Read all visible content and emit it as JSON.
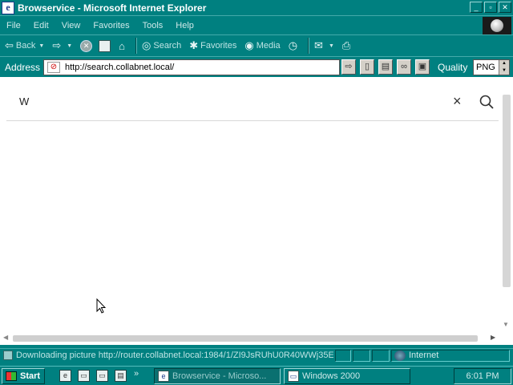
{
  "window": {
    "title": "Browservice - Microsoft Internet Explorer",
    "title_icon": "ie-e-icon"
  },
  "menu": [
    "File",
    "Edit",
    "View",
    "Favorites",
    "Tools",
    "Help"
  ],
  "toolbar": {
    "back_label": "Back",
    "search_label": "Search",
    "favorites_label": "Favorites",
    "media_label": "Media"
  },
  "address": {
    "label": "Address",
    "url": "http://search.collabnet.local/",
    "quality_label": "Quality",
    "quality_value": "PNG"
  },
  "page": {
    "search_value": "W",
    "close_glyph": "×"
  },
  "status": {
    "text": "Downloading picture http://router.collabnet.local:1984/1/ZI9JsRUhU0R40WWj35E",
    "zone": "Internet"
  },
  "taskbar": {
    "start_label": "Start",
    "more_glyph": "»",
    "tasks": [
      {
        "label": "Browservice - Microso..."
      },
      {
        "label": "Windows 2000"
      }
    ],
    "clock": "6:01 PM"
  },
  "colors": {
    "desktop": "#008080",
    "page_bg": "#ffffff"
  }
}
